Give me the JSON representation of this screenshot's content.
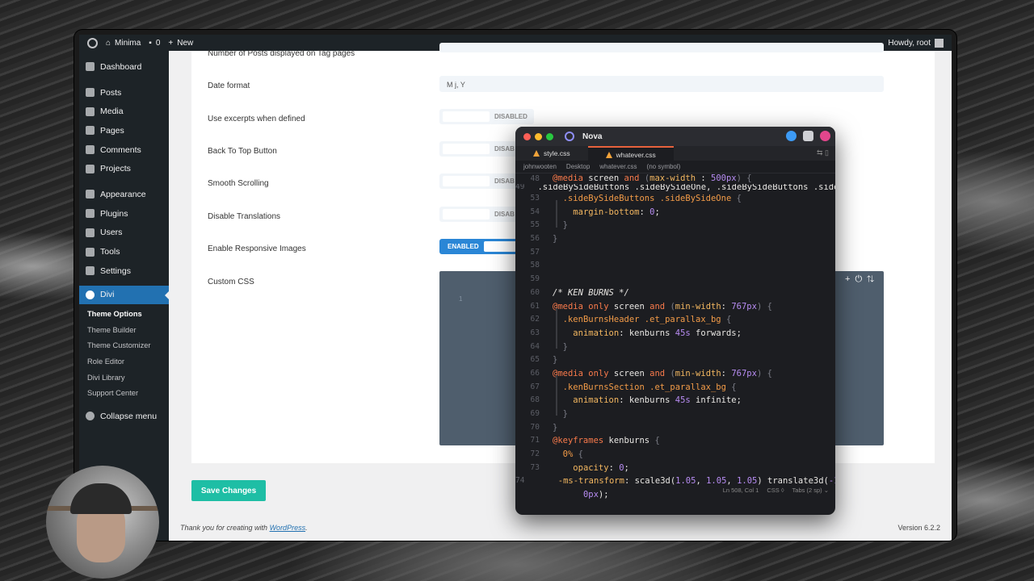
{
  "adminbar": {
    "site": "Minima",
    "comments": "0",
    "new": "New",
    "howdy": "Howdy, root"
  },
  "menu": {
    "items": [
      "Dashboard",
      "Posts",
      "Media",
      "Pages",
      "Comments",
      "Projects",
      "Appearance",
      "Plugins",
      "Users",
      "Tools",
      "Settings"
    ],
    "divi": "Divi",
    "submenu": [
      "Theme Options",
      "Theme Builder",
      "Theme Customizer",
      "Role Editor",
      "Divi Library",
      "Support Center"
    ],
    "collapse": "Collapse menu"
  },
  "settings": {
    "tag_pages": "Number of Posts displayed on Tag pages",
    "date_format": "Date format",
    "date_format_value": "M j, Y",
    "use_excerpts": "Use excerpts when defined",
    "back_to_top": "Back To Top Button",
    "smooth_scrolling": "Smooth Scrolling",
    "disable_translations": "Disable Translations",
    "responsive_images": "Enable Responsive Images",
    "custom_css": "Custom CSS",
    "disabled": "DISABLED",
    "disab": "DISAB",
    "enabled": "ENABLED",
    "css_line": "1"
  },
  "save_button": "Save Changes",
  "footer": {
    "thanks": "Thank you for creating with ",
    "wordpress": "WordPress",
    "period": ".",
    "version": "Version 6.2.2"
  },
  "nova": {
    "app": "Nova",
    "tabs": [
      "style.css",
      "whatever.css"
    ],
    "breadcrumb": [
      "johnwooten",
      "Desktop",
      "whatever.css",
      "(no symbol)"
    ],
    "status": {
      "pos": "Ln 508, Col 1",
      "lang": "CSS ◊",
      "indent": "Tabs (2 sp) ⌄"
    },
    "sticky": "@media screen and (max-width : 500px) {",
    "line49": ".sideBySideButtons .sideBySideOne, .sideBySideButtons .sideBySideT…"
  },
  "colors": {
    "divi": "#2271b1",
    "save": "#1ebea5",
    "toggle_on": "#2a86d6"
  }
}
